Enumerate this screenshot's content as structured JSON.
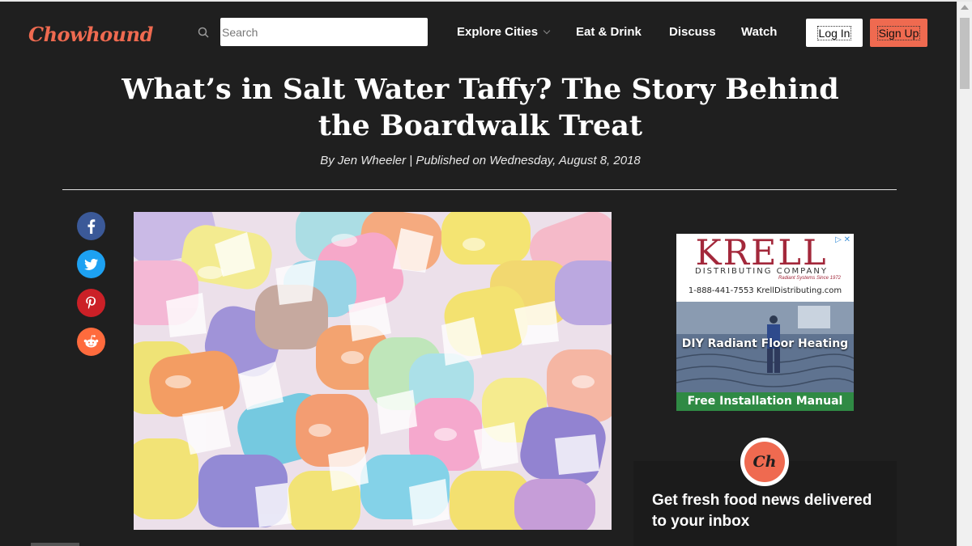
{
  "header": {
    "logo": "Chowhound",
    "search_placeholder": "Search",
    "nav": [
      "Explore Cities",
      "Eat & Drink",
      "Discuss",
      "Watch"
    ],
    "login_label": "Log In",
    "signup_label": "Sign Up"
  },
  "article": {
    "title_line1": "What’s in Salt Water Taffy? The Story Behind",
    "title_line2": "the Boardwalk Treat",
    "byline": "By Jen Wheeler | Published on Wednesday, August 8, 2018",
    "hero_image": "salt water taffy candies"
  },
  "share": {
    "buttons": [
      {
        "icon": "facebook-icon",
        "color": "#3b5998"
      },
      {
        "icon": "twitter-icon",
        "color": "#1da1f2"
      },
      {
        "icon": "pinterest-icon",
        "color": "#cb2027"
      },
      {
        "icon": "reddit-icon",
        "color": "#ff6b3d"
      }
    ]
  },
  "ad": {
    "brand": "KRELL",
    "subtitle": "DISTRIBUTING COMPANY",
    "tagline": "Radiant Systems Since 1972",
    "contact": "1-888-441-7553  KrellDistributing.com",
    "headline": "DIY Radiant Floor Heating",
    "cta": "Free Installation Manual",
    "badge": "▷ ✕"
  },
  "newsletter": {
    "badge": "Ch",
    "title": "Get fresh food news delivered to your inbox"
  },
  "colors": {
    "brand": "#ef6a50",
    "background": "#1f1f1f"
  }
}
